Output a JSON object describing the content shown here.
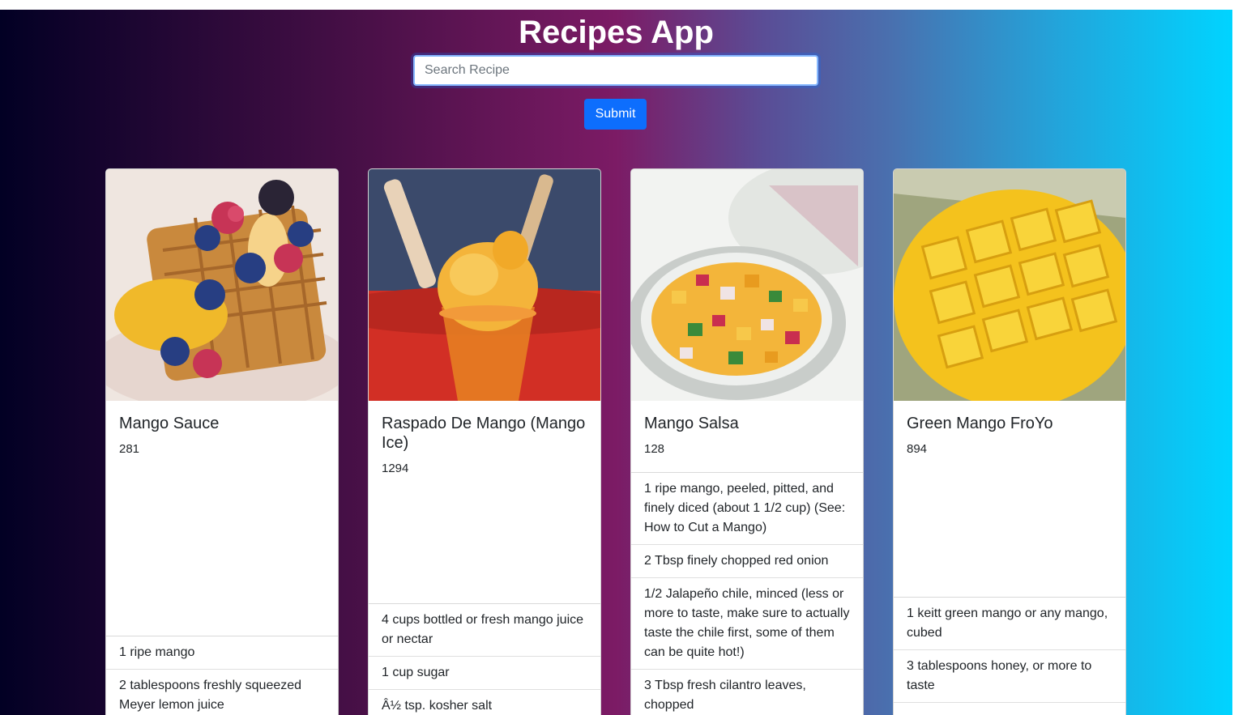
{
  "app": {
    "title": "Recipes App"
  },
  "search": {
    "placeholder": "Search Recipe",
    "value": ""
  },
  "submit": {
    "label": "Submit"
  },
  "recipes": [
    {
      "title": "Mango Sauce",
      "number": "281",
      "image": "waffles-with-berries-and-mango-sauce",
      "ingredients": [
        "1 ripe mango",
        "2 tablespoons freshly squeezed Meyer lemon juice"
      ]
    },
    {
      "title": "Raspado De Mango (Mango Ice)",
      "number": "1294",
      "image": "mango-ice-in-cup",
      "ingredients": [
        "4 cups bottled or fresh mango juice or nectar",
        "1 cup sugar",
        "Â½ tsp. kosher salt"
      ]
    },
    {
      "title": "Mango Salsa",
      "number": "128",
      "image": "bowl-of-mango-salsa",
      "ingredients": [
        "1 ripe mango, peeled, pitted, and finely diced (about 1 1/2 cup) (See: How to Cut a Mango)",
        "2 Tbsp finely chopped red onion",
        "1/2 Jalapeño chile, minced (less or more to taste, make sure to actually taste the chile first, some of them can be quite hot!)",
        "3 Tbsp fresh cilantro leaves, chopped"
      ]
    },
    {
      "title": "Green Mango FroYo",
      "number": "894",
      "image": "cut-mango-cubes",
      "ingredients": [
        "1 keitt green mango or any mango, cubed",
        "3 tablespoons honey, or more to taste"
      ]
    }
  ],
  "colors": {
    "accent": "#0d6efd",
    "gradient_start": "#020024",
    "gradient_mid": "#7c1b65",
    "gradient_end": "#00d4ff"
  }
}
